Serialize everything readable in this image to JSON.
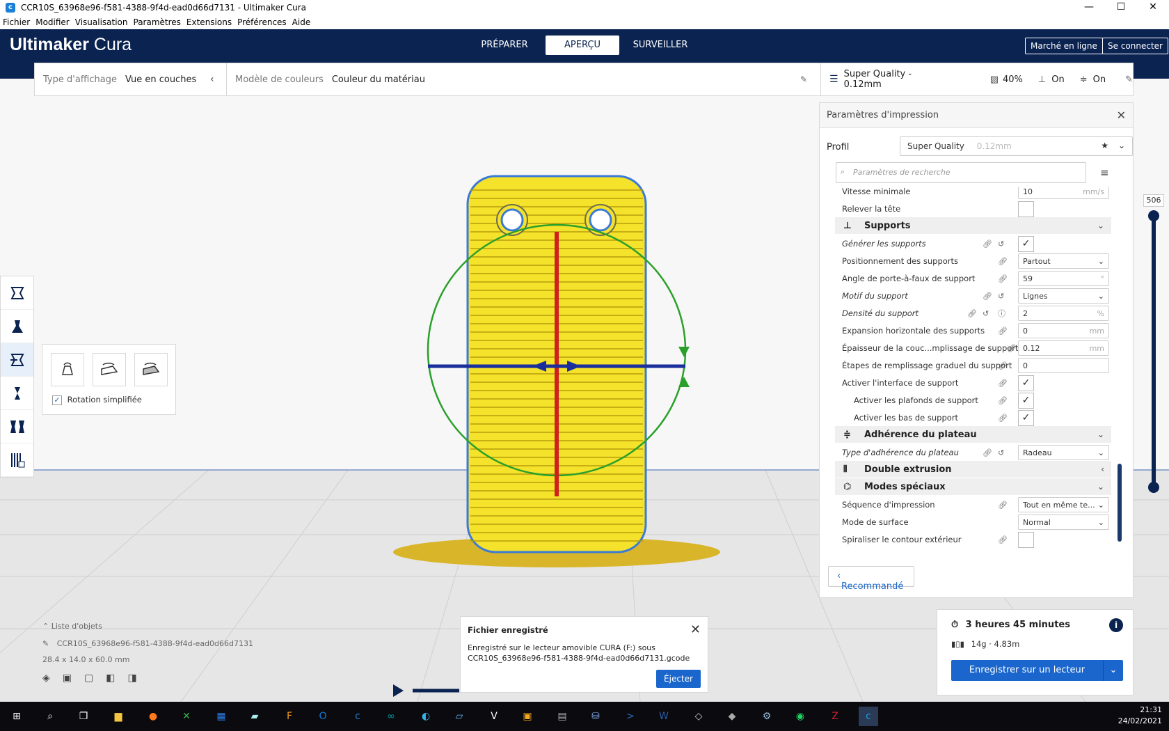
{
  "window": {
    "title": "CCR10S_63968e96-f581-4388-9f4d-ead0d66d7131 - Ultimaker Cura",
    "controls": [
      "—",
      "☐",
      "✕"
    ]
  },
  "menu": [
    "Fichier",
    "Modifier",
    "Visualisation",
    "Paramètres",
    "Extensions",
    "Préférences",
    "Aide"
  ],
  "header": {
    "brand_strong": "Ultimaker",
    "brand_light": " Cura",
    "tabs": [
      "PRÉPARER",
      "APERÇU",
      "SURVEILLER"
    ],
    "active_tab": "APERÇU",
    "marketplace": "Marché en ligne",
    "signin": "Se connecter"
  },
  "viewbar": {
    "type_label": "Type d'affichage",
    "type_value": "Vue en couches",
    "color_label": "Modèle de couleurs",
    "color_value": "Couleur du matériau"
  },
  "printbar": {
    "profile": "Super Quality - 0.12mm",
    "infill": "40%",
    "support": "On",
    "adhesion": "On"
  },
  "rotate_panel": {
    "checkbox_label": "Rotation simplifiée",
    "checked": true
  },
  "settings": {
    "title": "Paramètres d'impression",
    "profile_label": "Profil",
    "profile_value": "Super Quality",
    "profile_layer": "0.12mm",
    "search_placeholder": "Paramètres de recherche",
    "partial_top_label": "Vitesse minimale",
    "partial_top_value": "10",
    "partial_top_unit": "mm/s",
    "rows": [
      {
        "label": "Relever la tête",
        "kind": "checkbox",
        "checked": false
      },
      {
        "label": "Supports",
        "kind": "category"
      },
      {
        "label": "Générer les supports",
        "kind": "checkbox",
        "checked": true
      },
      {
        "label": "Positionnement des supports",
        "kind": "select",
        "value": "Partout"
      },
      {
        "label": "Angle de porte-à-faux de support",
        "kind": "number",
        "value": "59",
        "unit": "°"
      },
      {
        "label": "Motif du support",
        "kind": "select",
        "value": "Lignes"
      },
      {
        "label": "Densité du support",
        "kind": "number",
        "value": "2",
        "unit": "%"
      },
      {
        "label": "Expansion horizontale des supports",
        "kind": "number",
        "value": "0",
        "unit": "mm"
      },
      {
        "label": "Épaisseur de la couc...mplissage de support",
        "kind": "number",
        "value": "0.12",
        "unit": "mm"
      },
      {
        "label": "Étapes de remplissage graduel du support",
        "kind": "number",
        "value": "0",
        "unit": ""
      },
      {
        "label": "Activer l'interface de support",
        "kind": "checkbox",
        "checked": true
      },
      {
        "label": "Activer les plafonds de support",
        "kind": "checkbox",
        "checked": true
      },
      {
        "label": "Activer les bas de support",
        "kind": "checkbox",
        "checked": true
      },
      {
        "label": "Adhérence du plateau",
        "kind": "category"
      },
      {
        "label": "Type d'adhérence du plateau",
        "kind": "select",
        "value": "Radeau"
      },
      {
        "label": "Double extrusion",
        "kind": "category"
      },
      {
        "label": "Modes spéciaux",
        "kind": "category"
      },
      {
        "label": "Séquence d'impression",
        "kind": "select",
        "value": "Tout en même te..."
      },
      {
        "label": "Mode de surface",
        "kind": "select",
        "value": "Normal"
      },
      {
        "label": "Spiraliser le contour extérieur",
        "kind": "checkbox",
        "checked": false
      }
    ],
    "recommended": "Recommandé"
  },
  "layer_slider": {
    "label": "506"
  },
  "objects": {
    "list_label": "Liste d'objets",
    "name": "CCR10S_63968e96-f581-4388-9f4d-ead0d66d7131",
    "dims": "28.4 x 14.0 x 60.0 mm"
  },
  "toast": {
    "title": "Fichier enregistré",
    "line1": "Enregistré sur le lecteur amovible CURA (F:) sous",
    "line2": "CCR10S_63968e96-f581-4388-9f4d-ead0d66d7131.gcode",
    "button": "Éjecter"
  },
  "action": {
    "time": "3 heures 45 minutes",
    "material": "14g · 4.83m",
    "save": "Enregistrer sur un lecteur amovible"
  },
  "taskbar": {
    "time": "21:31",
    "date": "24/02/2021"
  },
  "colors": {
    "header": "#0b2350",
    "accent": "#1a66cc",
    "model": "#f5e22a",
    "raft": "#d9b52a"
  }
}
